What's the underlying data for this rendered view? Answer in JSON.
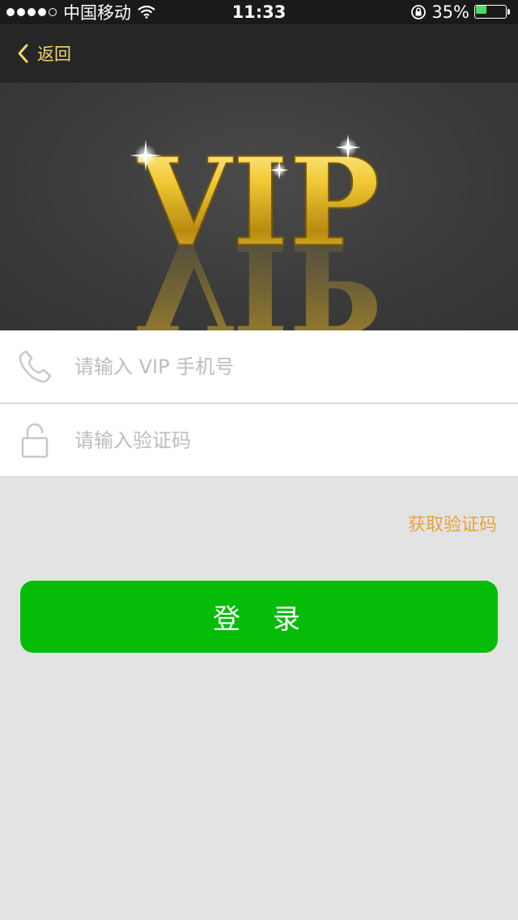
{
  "status_bar": {
    "carrier": "中国移动",
    "time": "11:33",
    "battery": "35%",
    "battery_level": 0.35,
    "battery_color": "#4cd964"
  },
  "nav": {
    "back_label": "返回",
    "accent_color": "#f5d36c"
  },
  "banner": {
    "logo_text": "VIP"
  },
  "form": {
    "phone": {
      "placeholder": "请输入 VIP 手机号",
      "value": "",
      "icon": "phone-icon"
    },
    "code": {
      "placeholder": "请输入验证码",
      "value": "",
      "icon": "unlock-icon"
    }
  },
  "get_code_label": "获取验证码",
  "get_code_color": "#e8a33a",
  "login_label": "登录",
  "login_color": "#05bd09"
}
